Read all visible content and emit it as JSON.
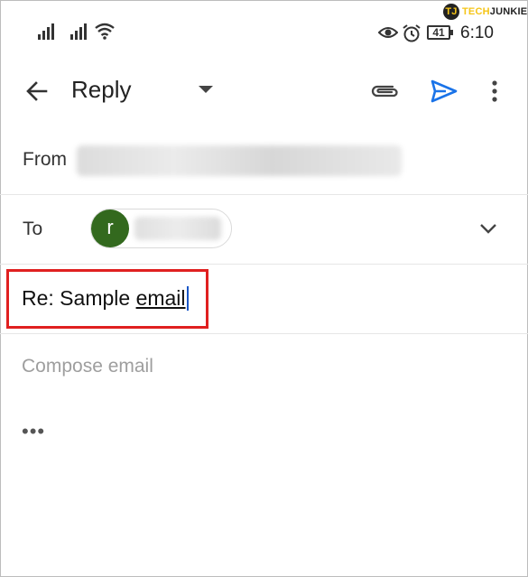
{
  "status_bar": {
    "time": "6:10",
    "battery": "41",
    "icons": [
      "signal-icon",
      "signal-icon",
      "wifi-icon",
      "eye-icon",
      "alarm-icon",
      "battery-icon"
    ]
  },
  "watermark": {
    "logo_letter": "TJ",
    "text_part1": "TECH",
    "text_part2": "JUNKIE"
  },
  "app_bar": {
    "title": "Reply",
    "icons": [
      "back-arrow-icon",
      "dropdown-caret-icon",
      "attachment-icon",
      "send-icon",
      "more-vert-icon"
    ],
    "accent_color": "#1a73e8"
  },
  "from": {
    "label": "From"
  },
  "to": {
    "label": "To",
    "chip_avatar_letter": "r",
    "avatar_color": "#33691e"
  },
  "subject": {
    "prefix": "Re: Sample ",
    "word": "email",
    "highlight_color": "#e02020"
  },
  "body": {
    "placeholder": "Compose email",
    "more_quoted": "•••"
  }
}
